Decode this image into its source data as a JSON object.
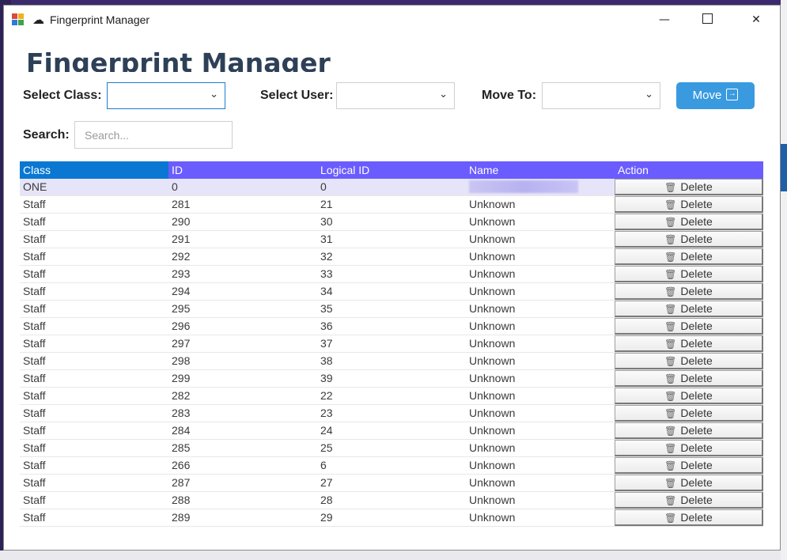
{
  "window": {
    "title": "Fingerprint Manager",
    "title_glyph": "☁"
  },
  "page": {
    "heading": "Fingerprint Manager"
  },
  "controls": {
    "select_class_label": "Select Class:",
    "select_class_value": "",
    "select_user_label": "Select User:",
    "select_user_value": "",
    "move_to_label": "Move To:",
    "move_to_value": "",
    "move_button_label": "Move",
    "search_label": "Search:",
    "search_placeholder": "Search..."
  },
  "colors": {
    "header_bg": "#6a5cff",
    "header_first_col": "#0a78d2",
    "move_button": "#3a9ae0",
    "selected_row": "#e6e4f8",
    "heading": "#2d4057"
  },
  "table": {
    "columns": [
      "Class",
      "ID",
      "Logical ID",
      "Name",
      "Action"
    ],
    "delete_label": "Delete",
    "rows": [
      {
        "class": "ONE",
        "id": "0",
        "logical_id": "0",
        "name": ""
      },
      {
        "class": "Staff",
        "id": "281",
        "logical_id": "21",
        "name": "Unknown"
      },
      {
        "class": "Staff",
        "id": "290",
        "logical_id": "30",
        "name": "Unknown"
      },
      {
        "class": "Staff",
        "id": "291",
        "logical_id": "31",
        "name": "Unknown"
      },
      {
        "class": "Staff",
        "id": "292",
        "logical_id": "32",
        "name": "Unknown"
      },
      {
        "class": "Staff",
        "id": "293",
        "logical_id": "33",
        "name": "Unknown"
      },
      {
        "class": "Staff",
        "id": "294",
        "logical_id": "34",
        "name": "Unknown"
      },
      {
        "class": "Staff",
        "id": "295",
        "logical_id": "35",
        "name": "Unknown"
      },
      {
        "class": "Staff",
        "id": "296",
        "logical_id": "36",
        "name": "Unknown"
      },
      {
        "class": "Staff",
        "id": "297",
        "logical_id": "37",
        "name": "Unknown"
      },
      {
        "class": "Staff",
        "id": "298",
        "logical_id": "38",
        "name": "Unknown"
      },
      {
        "class": "Staff",
        "id": "299",
        "logical_id": "39",
        "name": "Unknown"
      },
      {
        "class": "Staff",
        "id": "282",
        "logical_id": "22",
        "name": "Unknown"
      },
      {
        "class": "Staff",
        "id": "283",
        "logical_id": "23",
        "name": "Unknown"
      },
      {
        "class": "Staff",
        "id": "284",
        "logical_id": "24",
        "name": "Unknown"
      },
      {
        "class": "Staff",
        "id": "285",
        "logical_id": "25",
        "name": "Unknown"
      },
      {
        "class": "Staff",
        "id": "266",
        "logical_id": "6",
        "name": "Unknown"
      },
      {
        "class": "Staff",
        "id": "287",
        "logical_id": "27",
        "name": "Unknown"
      },
      {
        "class": "Staff",
        "id": "288",
        "logical_id": "28",
        "name": "Unknown"
      },
      {
        "class": "Staff",
        "id": "289",
        "logical_id": "29",
        "name": "Unknown"
      }
    ]
  }
}
